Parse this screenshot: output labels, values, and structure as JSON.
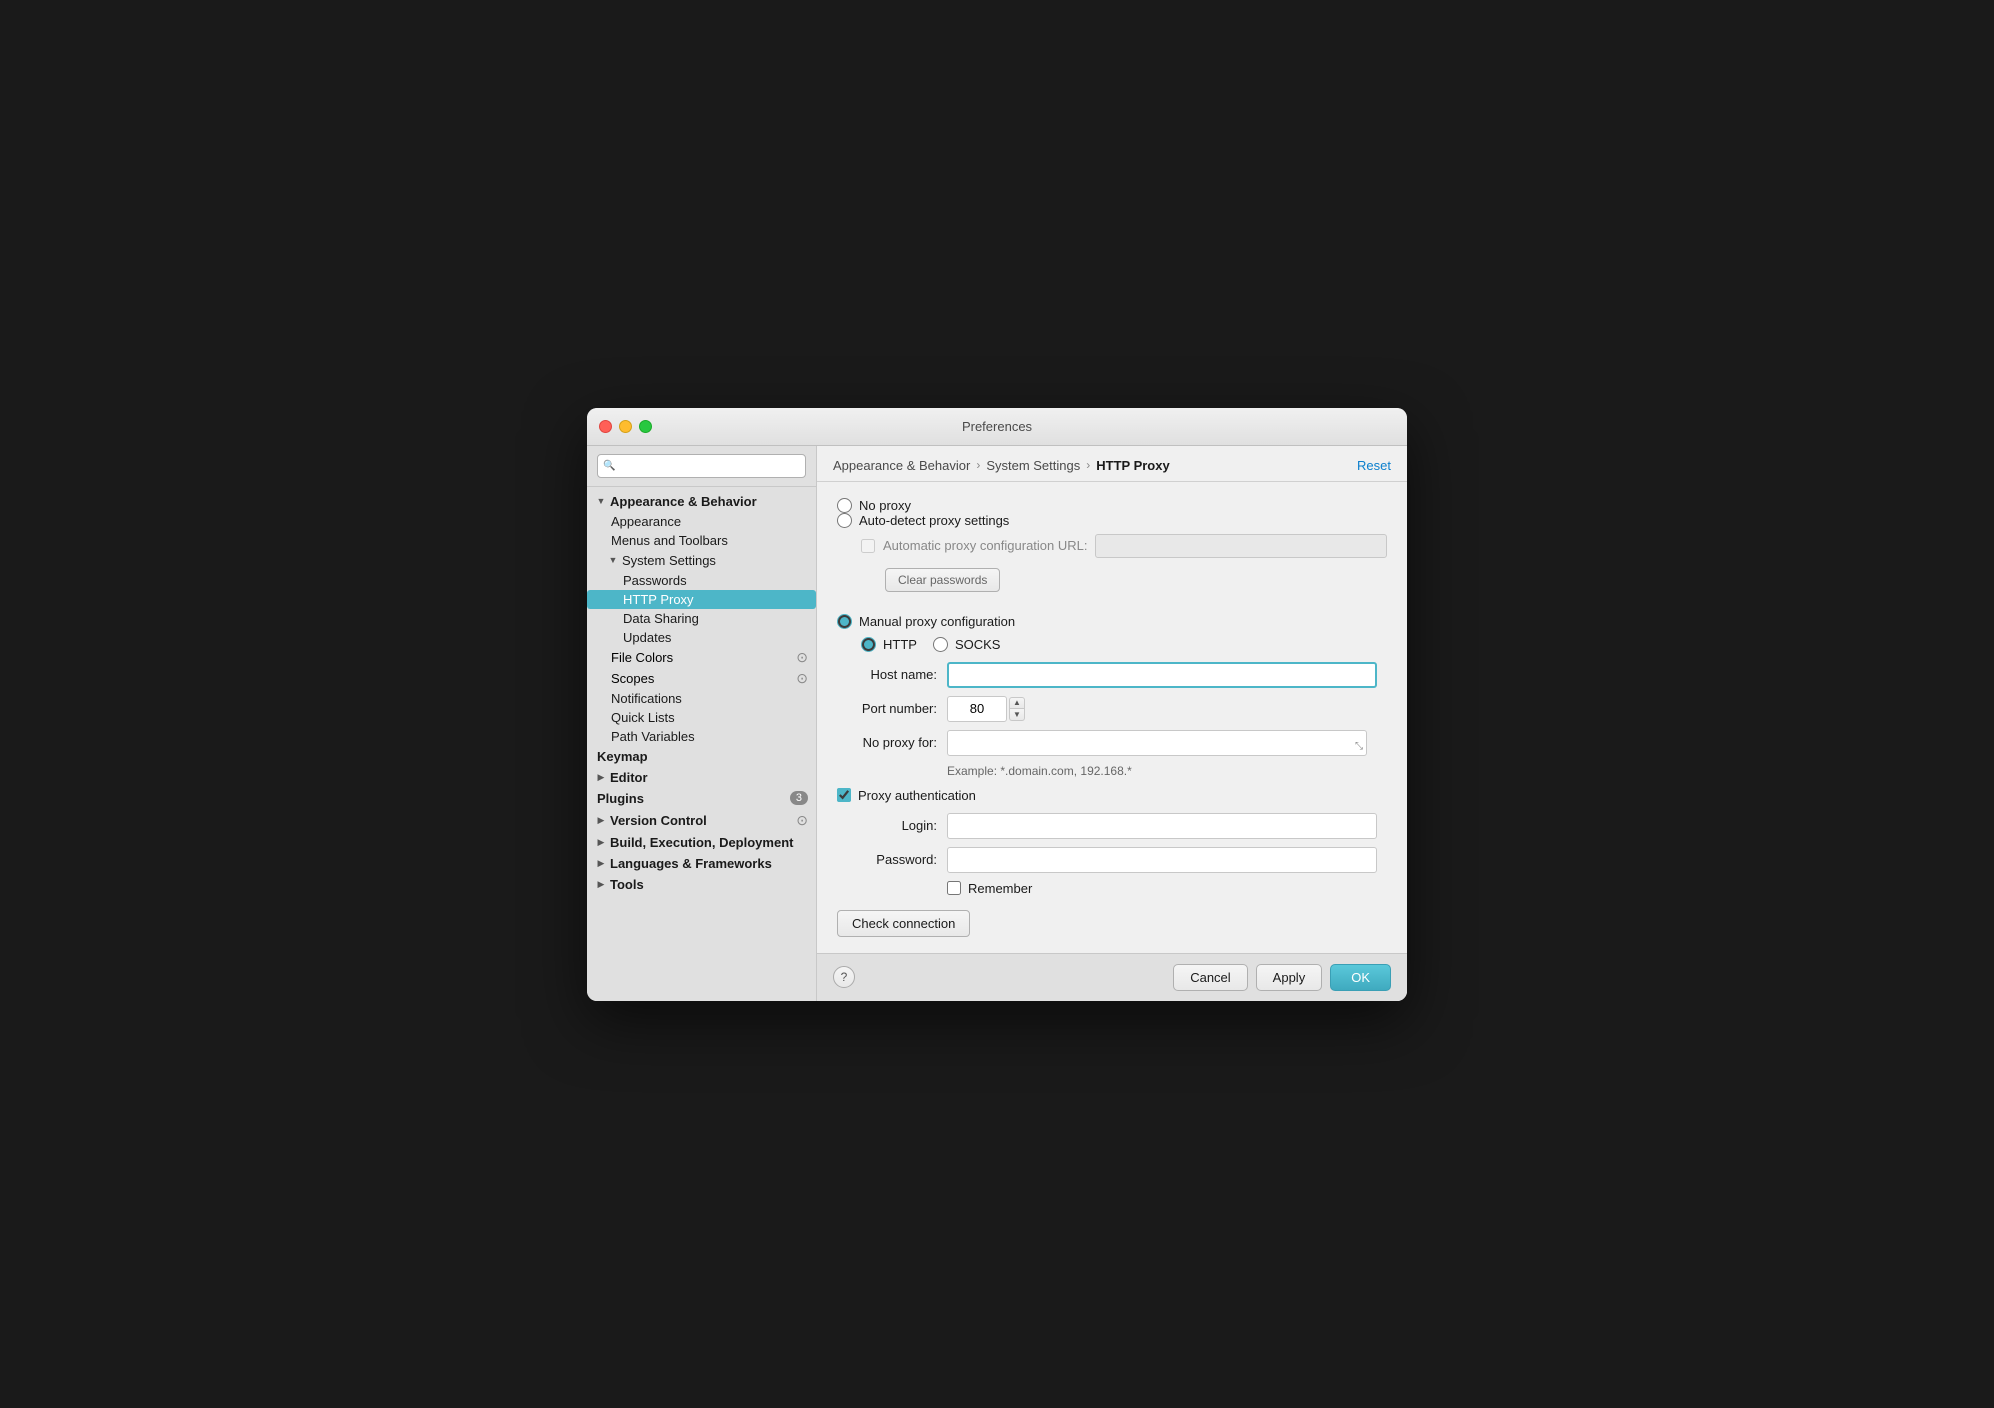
{
  "window": {
    "title": "Preferences"
  },
  "sidebar": {
    "search_placeholder": "🔍",
    "sections": [
      {
        "id": "appearance-behavior",
        "label": "Appearance & Behavior",
        "expanded": true,
        "children": [
          {
            "id": "appearance",
            "label": "Appearance",
            "indent": 1
          },
          {
            "id": "menus-toolbars",
            "label": "Menus and Toolbars",
            "indent": 1
          },
          {
            "id": "system-settings",
            "label": "System Settings",
            "expanded": true,
            "indent": 1,
            "children": [
              {
                "id": "passwords",
                "label": "Passwords",
                "indent": 2
              },
              {
                "id": "http-proxy",
                "label": "HTTP Proxy",
                "indent": 2,
                "active": true
              },
              {
                "id": "data-sharing",
                "label": "Data Sharing",
                "indent": 2
              },
              {
                "id": "updates",
                "label": "Updates",
                "indent": 2
              }
            ]
          },
          {
            "id": "file-colors",
            "label": "File Colors",
            "indent": 1,
            "hasIcon": true
          },
          {
            "id": "scopes",
            "label": "Scopes",
            "indent": 1,
            "hasIcon": true
          },
          {
            "id": "notifications",
            "label": "Notifications",
            "indent": 1
          },
          {
            "id": "quick-lists",
            "label": "Quick Lists",
            "indent": 1
          },
          {
            "id": "path-variables",
            "label": "Path Variables",
            "indent": 1
          }
        ]
      },
      {
        "id": "keymap",
        "label": "Keymap",
        "bold": true
      },
      {
        "id": "editor",
        "label": "Editor",
        "bold": true,
        "collapsed": true
      },
      {
        "id": "plugins",
        "label": "Plugins",
        "bold": true,
        "badge": "3"
      },
      {
        "id": "version-control",
        "label": "Version Control",
        "bold": true,
        "collapsed": true,
        "hasIcon": true
      },
      {
        "id": "build-execution",
        "label": "Build, Execution, Deployment",
        "bold": true,
        "collapsed": true
      },
      {
        "id": "languages-frameworks",
        "label": "Languages & Frameworks",
        "bold": true,
        "collapsed": true
      },
      {
        "id": "tools",
        "label": "Tools",
        "bold": true,
        "collapsed": true
      }
    ]
  },
  "breadcrumb": {
    "items": [
      "Appearance & Behavior",
      "System Settings",
      "HTTP Proxy"
    ],
    "reset_label": "Reset"
  },
  "form": {
    "no_proxy_label": "No proxy",
    "auto_detect_label": "Auto-detect proxy settings",
    "auto_proxy_url_label": "Automatic proxy configuration URL:",
    "clear_passwords_label": "Clear passwords",
    "manual_proxy_label": "Manual proxy configuration",
    "http_label": "HTTP",
    "socks_label": "SOCKS",
    "host_name_label": "Host name:",
    "port_number_label": "Port number:",
    "port_value": "80",
    "no_proxy_for_label": "No proxy for:",
    "example_text": "Example: *.domain.com, 192.168.*",
    "proxy_auth_label": "Proxy authentication",
    "login_label": "Login:",
    "password_label": "Password:",
    "remember_label": "Remember",
    "check_connection_label": "Check connection"
  },
  "footer": {
    "cancel_label": "Cancel",
    "apply_label": "Apply",
    "ok_label": "OK",
    "help_label": "?"
  }
}
